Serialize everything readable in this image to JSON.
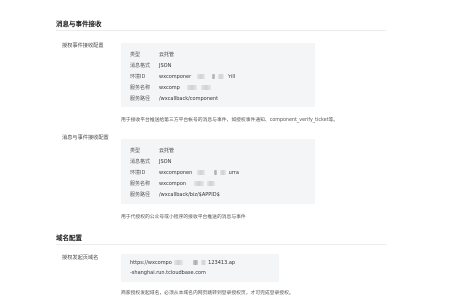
{
  "section1": {
    "title": "消息与事件接收"
  },
  "block1": {
    "label": "授权事件接收配置",
    "rows": [
      {
        "key": "类型",
        "value": "云托管"
      },
      {
        "key": "消息格式",
        "value": "JSON"
      },
      {
        "key": "环境ID",
        "value_prefix": "wxcomponer",
        "value_suffix": "'rill"
      },
      {
        "key": "服务名称",
        "value_prefix": "wxcomp",
        "value_suffix": ""
      },
      {
        "key": "服务路径",
        "value": "/wxcallback/component"
      }
    ],
    "description": "用于接收平台推送给第三方平台帐号的消息与事件，如授权事件通知、component_verify_ticket等。"
  },
  "block2": {
    "label": "消息与事件接收配置",
    "rows": [
      {
        "key": "类型",
        "value": "云托管"
      },
      {
        "key": "消息格式",
        "value": "JSON"
      },
      {
        "key": "环境ID",
        "value_prefix": "wxcomponen",
        "value_suffix": "urra"
      },
      {
        "key": "服务名称",
        "value_prefix": "wxcompon",
        "value_suffix": ""
      },
      {
        "key": "服务路径",
        "value": "/wxcallback/biz/$APPID$"
      }
    ],
    "description": "用于代授权的公众号或小程序的接收平台推送的消息与事件"
  },
  "section2": {
    "title": "域名配置"
  },
  "block3": {
    "label": "授权发起页域名",
    "url_line1_prefix": "https://wxcompo",
    "url_line1_suffix": "123413.ap",
    "url_line2": "-shanghai.run.tcloudbase.com",
    "description": "商家授权发起域名，必须从本域名内网页跳转到登录授权页，才可完成登录授权。"
  }
}
